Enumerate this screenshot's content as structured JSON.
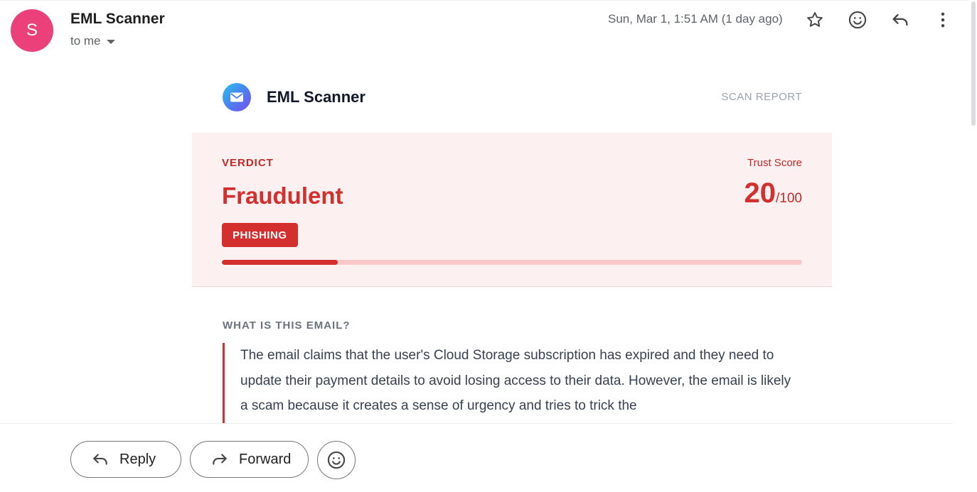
{
  "header": {
    "avatar_letter": "S",
    "sender_name": "EML Scanner",
    "recipient": "to me",
    "date": "Sun, Mar 1, 1:51 AM (1 day ago)",
    "icons": [
      "star-icon",
      "emoji-icon",
      "reply-icon",
      "more-vert-icon"
    ]
  },
  "report": {
    "brand": "EML Scanner",
    "tagline": "SCAN REPORT",
    "verdict_label": "VERDICT",
    "verdict": "Fraudulent",
    "badge": "PHISHING",
    "trust_label": "Trust Score",
    "trust_score": "20",
    "trust_max": "/100",
    "trust_fraction": 0.2,
    "section_title": "WHAT IS THIS EMAIL?",
    "summary": "The email claims that the user's Cloud Storage subscription has expired and they need to update their payment details to avoid losing access to their data. However, the email is likely a scam because it creates a sense of urgency and tries to trick the"
  },
  "actions": {
    "reply": "Reply",
    "forward": "Forward"
  },
  "colors": {
    "avatar": "#ec407a",
    "danger": "#d32f2f",
    "verdict_bg": "#fdf0f0"
  }
}
